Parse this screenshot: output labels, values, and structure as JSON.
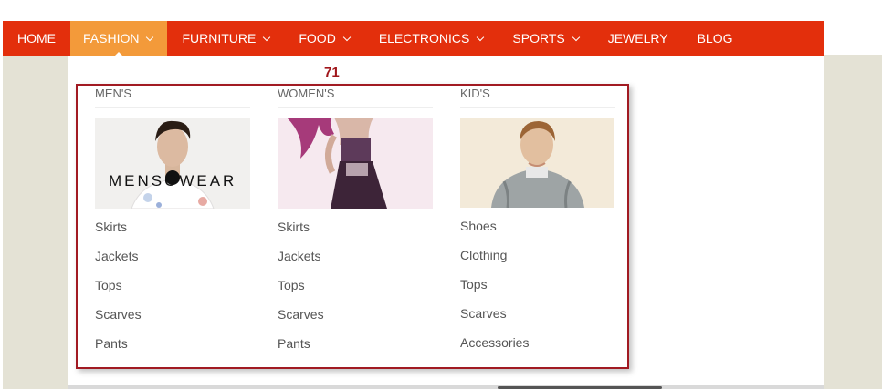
{
  "nav": {
    "items": [
      {
        "label": "HOME",
        "dropdown": false
      },
      {
        "label": "FASHION",
        "dropdown": true,
        "active": true
      },
      {
        "label": "FURNITURE",
        "dropdown": true
      },
      {
        "label": "FOOD",
        "dropdown": true
      },
      {
        "label": "ELECTRONICS",
        "dropdown": true
      },
      {
        "label": "SPORTS",
        "dropdown": true
      },
      {
        "label": "JEWELRY",
        "dropdown": false
      },
      {
        "label": "BLOG",
        "dropdown": false
      }
    ],
    "bar_color": "#e32f0c",
    "active_color": "#f39a3a"
  },
  "annotation": {
    "number": "71",
    "color": "#a0161b"
  },
  "dropdown": {
    "columns": [
      {
        "heading": "MEN'S",
        "image_text": "MENSOWEAR",
        "links": [
          "Skirts",
          "Jackets",
          "Tops",
          "Scarves",
          "Pants"
        ]
      },
      {
        "heading": "WOMEN'S",
        "links": [
          "Skirts",
          "Jackets",
          "Tops",
          "Scarves",
          "Pants"
        ]
      },
      {
        "heading": "KID'S",
        "links": [
          "Shoes",
          "Clothing",
          "Tops",
          "Scarves",
          "Accessories"
        ]
      }
    ]
  }
}
